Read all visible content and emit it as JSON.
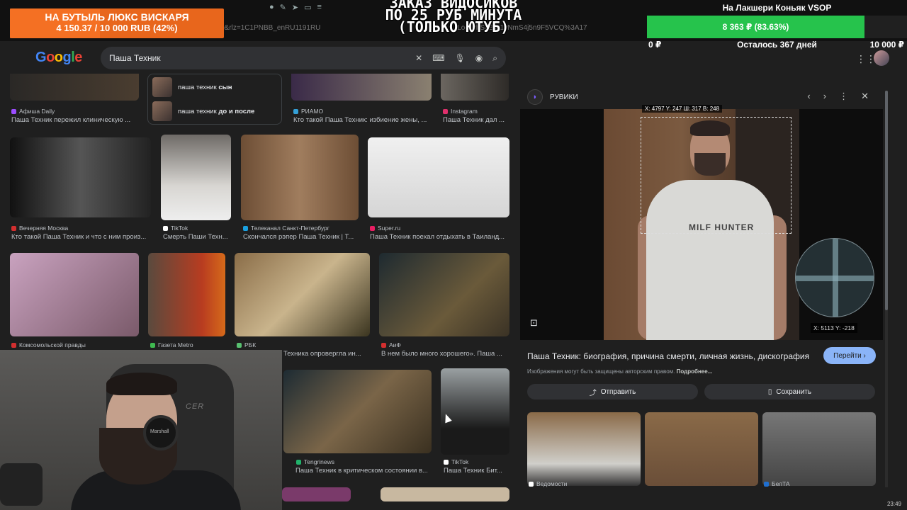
{
  "browser": {
    "url_fragment": "8e0&rlz=1C1PNBB_enRU1191RU",
    "url_tail": "Loo-PbSLBW1yNmS4j5n9F5VCQ%3A17"
  },
  "google": {
    "logo": [
      "G",
      "o",
      "o",
      "g",
      "l",
      "e"
    ],
    "search_value": "Паша Техник"
  },
  "related": [
    {
      "prefix": "паша техник ",
      "bold": "сын"
    },
    {
      "prefix": "паша техник ",
      "bold": "до и после"
    }
  ],
  "row0": [
    {
      "source": "Афиша Daily",
      "title": "Паша Техник пережил клиническую ...",
      "fav": "#9b4dff"
    },
    {
      "source": "РИАМО",
      "title": "Кто такой Паша Техник: избиение жены, ...",
      "fav": "#34a0d8"
    },
    {
      "source": "Instagram",
      "title": "Паша Техник дал ...",
      "fav": "#e1306c"
    }
  ],
  "row1": [
    {
      "source": "Вечерняя Москва",
      "title": "Кто такой Паша Техник и что с ним произ...",
      "fav": "#d32f2f"
    },
    {
      "source": "TikTok",
      "title": "Смерть Паши Техн...",
      "fav": "#ffffff"
    },
    {
      "source": "Телеканал Санкт-Петербург",
      "title": "Скончался рэпер Паша Техник | Т...",
      "fav": "#1aa0e0"
    },
    {
      "source": "Super.ru",
      "title": "Паша Техник поехал отдыхать в Таиланд...",
      "fav": "#e91e63"
    }
  ],
  "row2": [
    {
      "source": "Комсомольской правды",
      "title": "",
      "fav": "#d32f2f"
    },
    {
      "source": "Газета Metro",
      "title": "",
      "fav": "#3fb950"
    },
    {
      "source": "РБК",
      "title": "Техника опровергла ин...",
      "fav": "#58c070"
    },
    {
      "source": "АиФ",
      "title": "В нем было много хорошего». Паша ...",
      "fav": "#d32f2f"
    }
  ],
  "row3": [
    {
      "source": "Tengrinews",
      "title": "Паша Техник в критическом состоянии в...",
      "fav": "#21b36b"
    },
    {
      "source": "TikTok",
      "title": "Паша Техник Бит...",
      "fav": "#ffffff"
    }
  ],
  "panel": {
    "source_name": "РУВИКИ",
    "selection_coords": "X: 4797 Y: 247 Ш: 317 В: 248",
    "magnifier_coords": "X: 5113 Y: -218",
    "shirt_print": "MILF HUNTER",
    "title": "Паша Техник: биография, причина смерти, личная жизнь, дискография",
    "go_label": "Перейти",
    "copyright_note": "Изображения могут быть защищены авторским правом.",
    "more_link": "Подробнее...",
    "share_label": "Отправить",
    "save_label": "Сохранить",
    "similar": [
      {
        "source": "Ведомости"
      },
      {
        "source": ""
      },
      {
        "source": "БелТА"
      }
    ]
  },
  "overlay": {
    "donate_left_line1": "НА БУТЫЛЬ ЛЮКС ВИСКАРЯ",
    "donate_left_line2": "4 150.37 / 10 000 RUB (42%)",
    "donate_left_progress": 0.42,
    "caption_lines": [
      "ЗАКАЗ ВИДОСИКОВ",
      "ПО 25 РУБ МИНУТА",
      "(ТОЛЬКО ЮТУБ)"
    ],
    "goal_title": "На Лакшери Коньяк VSOP",
    "goal_value": "8 363 ₽ (83.63%)",
    "goal_progress": 0.8363,
    "goal_min": "0 ₽",
    "goal_days": "Осталось 367 дней",
    "goal_max": "10 000 ₽"
  },
  "webcam": {
    "chair_brand": "CER",
    "headphone_brand": "Marshall"
  },
  "clock": "23:49",
  "colors": {
    "accent_blue": "#8ab4f8",
    "goal_green": "#26c34c",
    "donate_orange": "#e8661c"
  }
}
